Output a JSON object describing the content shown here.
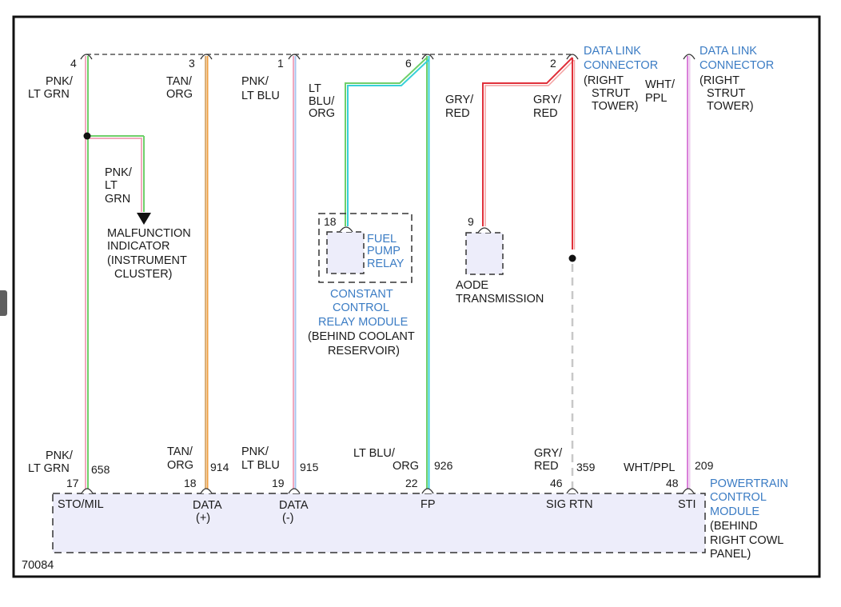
{
  "figure_id": "70084",
  "colors": {
    "label_blue": "#3b7cc4",
    "pink": "#f2a8be",
    "lt_green": "#6fcf6a",
    "tan": "#d9b07a",
    "orange": "#f0a040",
    "lt_blue": "#a9c5ef",
    "cyan": "#38d0d8",
    "gray": "#c8c8c8",
    "red": "#e0303a",
    "white": "#ffffff",
    "purple": "#d980d9",
    "module_fill": "#ededfa"
  },
  "dlc": {
    "pins": [
      "4",
      "3",
      "1",
      "6",
      "2"
    ],
    "label": [
      "DATA LINK",
      "CONNECTOR"
    ],
    "location": [
      "(RIGHT",
      "STRUT",
      "TOWER)"
    ],
    "sti_label": [
      "DATA LINK",
      "CONNECTOR"
    ],
    "sti_location": [
      "(RIGHT",
      "STRUT",
      "TOWER)"
    ]
  },
  "wires_top": {
    "w4": [
      "PNK/",
      "LT GRN"
    ],
    "w3": [
      "TAN/",
      "ORG"
    ],
    "w1": [
      "PNK/",
      "LT BLU"
    ],
    "w6": [
      "LT",
      "BLU/",
      "ORG"
    ],
    "aode": [
      "GRY/",
      "RED"
    ],
    "w2": [
      "GRY/",
      "RED"
    ],
    "sti": [
      "WHT/",
      "PPL"
    ]
  },
  "mil": {
    "wire": [
      "PNK/",
      "LT",
      "GRN"
    ],
    "label": [
      "MALFUNCTION",
      "INDICATOR",
      "(INSTRUMENT",
      "CLUSTER)"
    ]
  },
  "relay": {
    "pin": "18",
    "label": [
      "FUEL",
      "PUMP",
      "RELAY"
    ],
    "module": [
      "CONSTANT",
      "CONTROL",
      "RELAY MODULE"
    ],
    "location": [
      "(BEHIND COOLANT",
      "RESERVOIR)"
    ]
  },
  "aode": {
    "pin": "9",
    "label": [
      "AODE",
      "TRANSMISSION"
    ]
  },
  "pcm": {
    "label": [
      "POWERTRAIN",
      "CONTROL",
      "MODULE"
    ],
    "location": [
      "(BEHIND",
      "RIGHT COWL",
      "PANEL)"
    ],
    "pins": [
      {
        "wire": [
          "PNK/",
          "LT GRN"
        ],
        "circuit": "658",
        "pin": "17",
        "name": "STO/MIL"
      },
      {
        "wire": [
          "TAN/",
          "ORG"
        ],
        "circuit": "914",
        "pin": "18",
        "name": "DATA",
        "sub": "(+)"
      },
      {
        "wire": [
          "PNK/",
          "LT BLU"
        ],
        "circuit": "915",
        "pin": "19",
        "name": "DATA",
        "sub": "(-)"
      },
      {
        "wire": [
          "LT BLU/",
          "ORG"
        ],
        "circuit": "926",
        "pin": "22",
        "name": "FP"
      },
      {
        "wire": [
          "GRY/",
          "RED"
        ],
        "circuit": "359",
        "pin": "46",
        "name": "SIG RTN"
      },
      {
        "wire": [
          "WHT/PPL"
        ],
        "circuit": "209",
        "pin": "48",
        "name": "STI"
      }
    ]
  }
}
